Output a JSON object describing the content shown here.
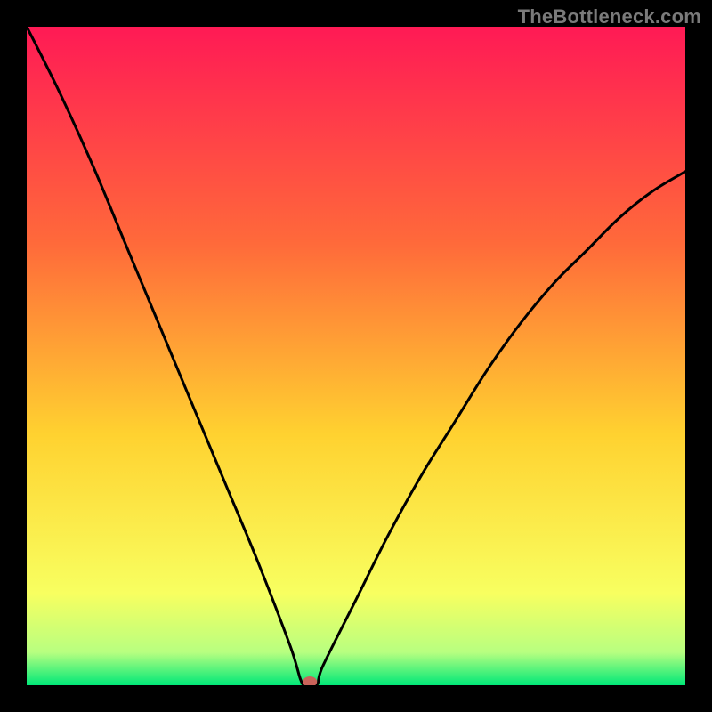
{
  "watermark": "TheBottleneck.com",
  "colors": {
    "bg_black": "#000000",
    "grad_top": "#ff1a55",
    "grad_mid1": "#ff6a3a",
    "grad_mid2": "#ffd230",
    "grad_low1": "#f8ff60",
    "grad_low2": "#b8ff80",
    "grad_bottom": "#00e878",
    "curve": "#000000",
    "marker": "#c9635a"
  },
  "chart_data": {
    "type": "line",
    "title": "",
    "xlabel": "",
    "ylabel": "",
    "xlim": [
      0,
      100
    ],
    "ylim": [
      0,
      100
    ],
    "minimum_x": 42,
    "marker": {
      "x": 43,
      "y": 0
    },
    "series": [
      {
        "name": "bottleneck-curve",
        "x": [
          0,
          5,
          10,
          15,
          20,
          25,
          30,
          35,
          40,
          42,
          44,
          45,
          50,
          55,
          60,
          65,
          70,
          75,
          80,
          85,
          90,
          95,
          100
        ],
        "values": [
          100,
          90,
          79,
          67,
          55,
          43,
          31,
          19,
          6,
          0,
          0,
          3,
          13,
          23,
          32,
          40,
          48,
          55,
          61,
          66,
          71,
          75,
          78
        ]
      }
    ]
  }
}
